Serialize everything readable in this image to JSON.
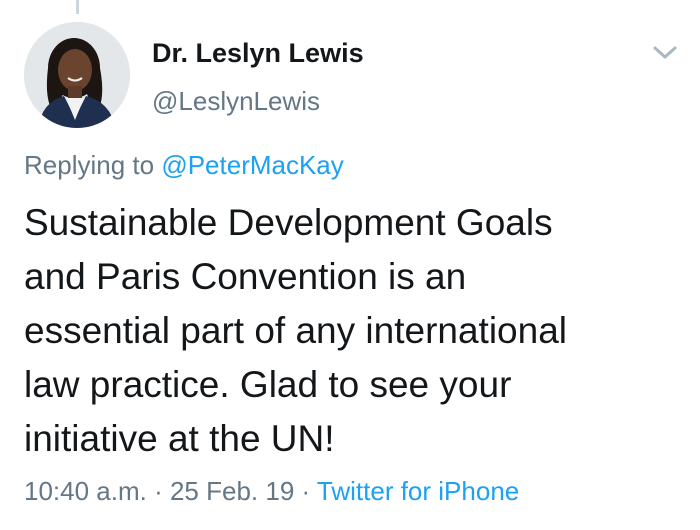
{
  "tweet": {
    "author": {
      "display_name": "Dr. Leslyn Lewis",
      "handle": "@LeslynLewis"
    },
    "reply": {
      "prefix": "Replying to",
      "mention": "@PeterMacKay"
    },
    "text_lines": [
      "Sustainable Development Goals",
      "and Paris Convention is an",
      "essential part of any international",
      "law practice. Glad to see your",
      "initiative at the UN!"
    ],
    "time": "10:40 a.m.",
    "separator": " · ",
    "date": "25 Feb. 19",
    "source": "Twitter for iPhone"
  },
  "icons": {
    "menu": "chevron-down-icon"
  },
  "colors": {
    "link": "#1da1f2",
    "secondary_text": "#657786",
    "primary_text": "#14171a",
    "thread_line": "#ccd6dd"
  }
}
